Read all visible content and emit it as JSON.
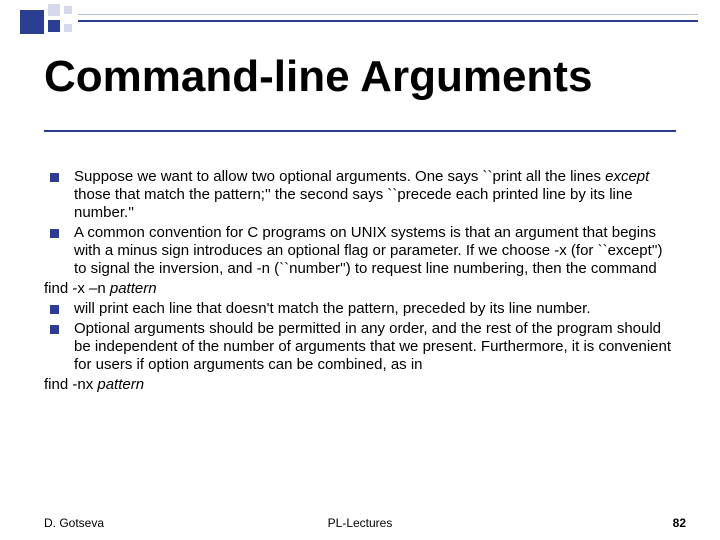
{
  "title": "Command-line Arguments",
  "items": [
    {
      "type": "bullet",
      "html": "Suppose we want to allow two optional arguments. One says ``print all the lines <em>except</em> those that match the pattern;'' the second says ``precede each printed line by its line number.''"
    },
    {
      "type": "bullet",
      "html": "A common convention for C programs on UNIX systems is that an argument that begins with a minus sign introduces an optional flag or parameter. If we choose -x (for ``except'') to signal the inversion, and -n (``number'') to request line numbering, then the command"
    },
    {
      "type": "plain",
      "html": "find -x –n <em>pattern</em>"
    },
    {
      "type": "bullet",
      "html": "will print each line that doesn't match the pattern, preceded by its line number."
    },
    {
      "type": "bullet",
      "html": "Optional arguments should be permitted in any order, and the rest of the program should be independent of the number of arguments that we present. Furthermore, it is convenient for users if option arguments can be combined, as in"
    },
    {
      "type": "plain",
      "html": "find -nx <em>pattern</em>"
    }
  ],
  "footer": {
    "author": "D. Gotseva",
    "center": "PL-Lectures",
    "page": "82"
  }
}
